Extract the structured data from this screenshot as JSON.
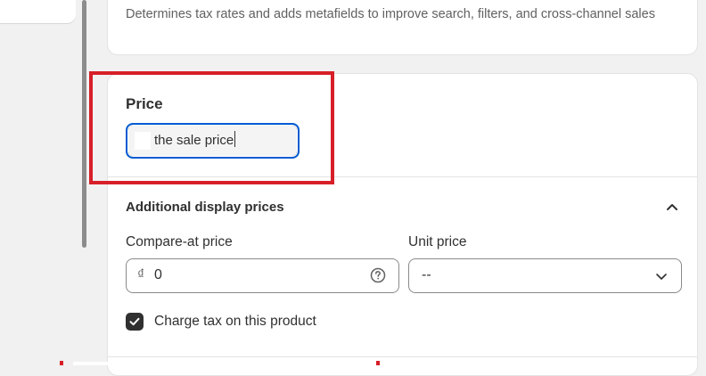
{
  "top_card": {
    "description": "Determines tax rates and adds metafields to improve search, filters, and cross-channel sales"
  },
  "price": {
    "title": "Price",
    "input_value": "the sale price"
  },
  "additional_display_prices": {
    "title": "Additional display prices",
    "toggle_icon": "chevron-up-icon",
    "compare_at": {
      "label": "Compare-at price",
      "currency_symbol": "₫",
      "value": "0",
      "help_icon": "question-circle-icon"
    },
    "unit_price": {
      "label": "Unit price",
      "selected": "--",
      "dropdown_icon": "chevron-down-icon"
    },
    "charge_tax": {
      "label": "Charge tax on this product",
      "checked": true
    }
  },
  "colors": {
    "highlight": "#d71f28",
    "focus_ring": "#005bd3",
    "checkbox": "#303030"
  }
}
